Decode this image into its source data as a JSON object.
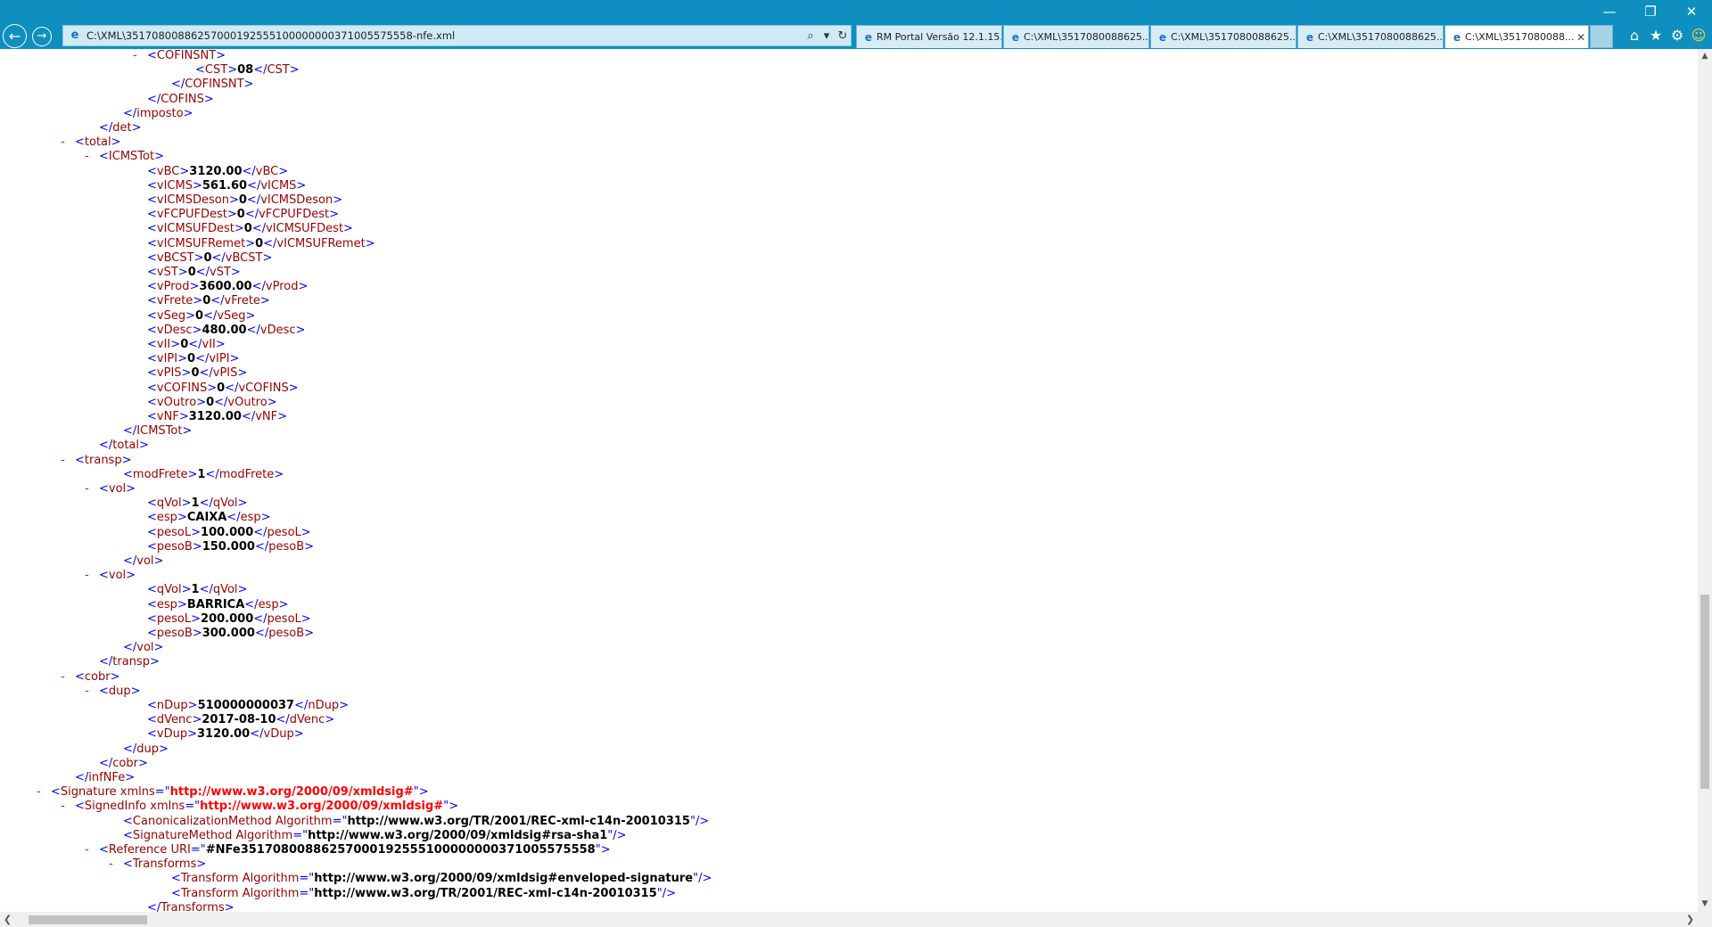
{
  "window": {
    "minimize": "—",
    "restore": "❐",
    "close": "✕"
  },
  "nav": {
    "back": "←",
    "forward": "→"
  },
  "address": {
    "url": "C:\\XML\\35170800886257000192555100000000371005575558-nfe.xml",
    "search": "⌕",
    "dropdown": "▾",
    "refresh": "↻"
  },
  "tabs": [
    {
      "label": "RM Portal Versão 12.1.15...",
      "active": false
    },
    {
      "label": "C:\\XML\\3517080088625...",
      "active": false
    },
    {
      "label": "C:\\XML\\3517080088625...",
      "active": false
    },
    {
      "label": "C:\\XML\\3517080088625...",
      "active": false
    },
    {
      "label": "C:\\XML\\3517080088...",
      "active": true,
      "close": "✕"
    }
  ],
  "tools": {
    "home": "⌂",
    "favorites": "★",
    "settings": "⚙",
    "feedback": "☺"
  },
  "xml_lines": [
    {
      "indent": 6,
      "minus": true,
      "open": "COFINSNT"
    },
    {
      "indent": 8,
      "open": "CST",
      "value": "08",
      "close": "CST"
    },
    {
      "indent": 7,
      "close": "COFINSNT"
    },
    {
      "indent": 6,
      "close": "COFINS"
    },
    {
      "indent": 5,
      "close": "imposto"
    },
    {
      "indent": 4,
      "close": "det"
    },
    {
      "indent": 3,
      "minus": true,
      "open": "total"
    },
    {
      "indent": 4,
      "minus": true,
      "open": "ICMSTot"
    },
    {
      "indent": 6,
      "open": "vBC",
      "value": "3120.00",
      "close": "vBC"
    },
    {
      "indent": 6,
      "open": "vICMS",
      "value": "561.60",
      "close": "vICMS"
    },
    {
      "indent": 6,
      "open": "vICMSDeson",
      "value": "0",
      "close": "vICMSDeson"
    },
    {
      "indent": 6,
      "open": "vFCPUFDest",
      "value": "0",
      "close": "vFCPUFDest"
    },
    {
      "indent": 6,
      "open": "vICMSUFDest",
      "value": "0",
      "close": "vICMSUFDest"
    },
    {
      "indent": 6,
      "open": "vICMSUFRemet",
      "value": "0",
      "close": "vICMSUFRemet"
    },
    {
      "indent": 6,
      "open": "vBCST",
      "value": "0",
      "close": "vBCST"
    },
    {
      "indent": 6,
      "open": "vST",
      "value": "0",
      "close": "vST"
    },
    {
      "indent": 6,
      "open": "vProd",
      "value": "3600.00",
      "close": "vProd"
    },
    {
      "indent": 6,
      "open": "vFrete",
      "value": "0",
      "close": "vFrete"
    },
    {
      "indent": 6,
      "open": "vSeg",
      "value": "0",
      "close": "vSeg"
    },
    {
      "indent": 6,
      "open": "vDesc",
      "value": "480.00",
      "close": "vDesc"
    },
    {
      "indent": 6,
      "open": "vII",
      "value": "0",
      "close": "vII"
    },
    {
      "indent": 6,
      "open": "vIPI",
      "value": "0",
      "close": "vIPI"
    },
    {
      "indent": 6,
      "open": "vPIS",
      "value": "0",
      "close": "vPIS"
    },
    {
      "indent": 6,
      "open": "vCOFINS",
      "value": "0",
      "close": "vCOFINS"
    },
    {
      "indent": 6,
      "open": "vOutro",
      "value": "0",
      "close": "vOutro"
    },
    {
      "indent": 6,
      "open": "vNF",
      "value": "3120.00",
      "close": "vNF"
    },
    {
      "indent": 5,
      "close": "ICMSTot"
    },
    {
      "indent": 4,
      "close": "total"
    },
    {
      "indent": 3,
      "minus": true,
      "open": "transp"
    },
    {
      "indent": 5,
      "open": "modFrete",
      "value": "1",
      "close": "modFrete"
    },
    {
      "indent": 4,
      "minus": true,
      "open": "vol"
    },
    {
      "indent": 6,
      "open": "qVol",
      "value": "1",
      "close": "qVol"
    },
    {
      "indent": 6,
      "open": "esp",
      "value": "CAIXA",
      "close": "esp"
    },
    {
      "indent": 6,
      "open": "pesoL",
      "value": "100.000",
      "close": "pesoL"
    },
    {
      "indent": 6,
      "open": "pesoB",
      "value": "150.000",
      "close": "pesoB"
    },
    {
      "indent": 5,
      "close": "vol"
    },
    {
      "indent": 4,
      "minus": true,
      "open": "vol"
    },
    {
      "indent": 6,
      "open": "qVol",
      "value": "1",
      "close": "qVol"
    },
    {
      "indent": 6,
      "open": "esp",
      "value": "BARRICA",
      "close": "esp"
    },
    {
      "indent": 6,
      "open": "pesoL",
      "value": "200.000",
      "close": "pesoL"
    },
    {
      "indent": 6,
      "open": "pesoB",
      "value": "300.000",
      "close": "pesoB"
    },
    {
      "indent": 5,
      "close": "vol"
    },
    {
      "indent": 4,
      "close": "transp"
    },
    {
      "indent": 3,
      "minus": true,
      "open": "cobr"
    },
    {
      "indent": 4,
      "minus": true,
      "open": "dup"
    },
    {
      "indent": 6,
      "open": "nDup",
      "value": "510000000037",
      "close": "nDup"
    },
    {
      "indent": 6,
      "open": "dVenc",
      "value": "2017-08-10",
      "close": "dVenc"
    },
    {
      "indent": 6,
      "open": "vDup",
      "value": "3120.00",
      "close": "vDup"
    },
    {
      "indent": 5,
      "close": "dup"
    },
    {
      "indent": 4,
      "close": "cobr"
    },
    {
      "indent": 3,
      "close": "infNFe"
    },
    {
      "indent": 2,
      "minus": true,
      "open": "Signature",
      "attr": "xmlns",
      "attrval": "http://www.w3.org/2000/09/xmldsig#",
      "attrred": true
    },
    {
      "indent": 3,
      "minus": true,
      "open": "SignedInfo",
      "attr": "xmlns",
      "attrval": "http://www.w3.org/2000/09/xmldsig#",
      "attrred": true
    },
    {
      "indent": 5,
      "open": "CanonicalizationMethod",
      "attr": "Algorithm",
      "attrval": "http://www.w3.org/TR/2001/REC-xml-c14n-20010315",
      "selfclose": true
    },
    {
      "indent": 5,
      "open": "SignatureMethod",
      "attr": "Algorithm",
      "attrval": "http://www.w3.org/2000/09/xmldsig#rsa-sha1",
      "selfclose": true
    },
    {
      "indent": 4,
      "minus": true,
      "open": "Reference",
      "attr": "URI",
      "attrval": "#NFe35170800886257000192555100000000371005575558"
    },
    {
      "indent": 5,
      "minus": true,
      "open": "Transforms"
    },
    {
      "indent": 7,
      "open": "Transform",
      "attr": "Algorithm",
      "attrval": "http://www.w3.org/2000/09/xmldsig#enveloped-signature",
      "selfclose": true
    },
    {
      "indent": 7,
      "open": "Transform",
      "attr": "Algorithm",
      "attrval": "http://www.w3.org/TR/2001/REC-xml-c14n-20010315",
      "selfclose": true
    },
    {
      "indent": 6,
      "close": "Transforms"
    }
  ],
  "scroll": {
    "up": "▲",
    "down": "▼",
    "left": "❮",
    "right": "❯"
  }
}
